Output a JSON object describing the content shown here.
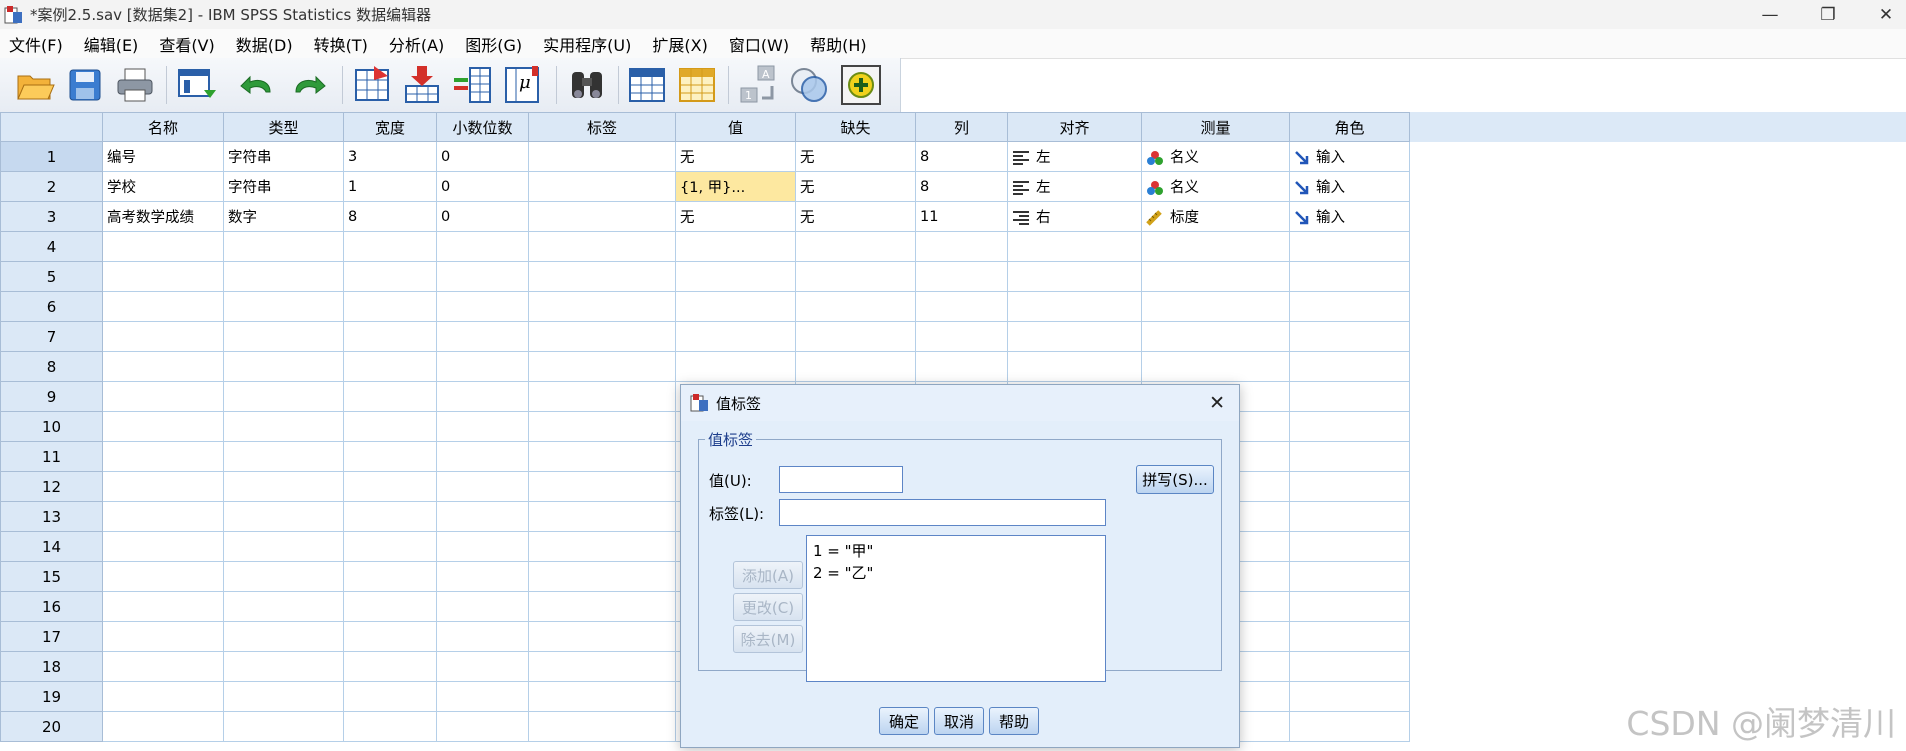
{
  "window": {
    "title": "*案例2.5.sav [数据集2] - IBM SPSS Statistics 数据编辑器",
    "minimize": "—",
    "restore": "❐",
    "close": "✕"
  },
  "menu": [
    "文件(F)",
    "编辑(E)",
    "查看(V)",
    "数据(D)",
    "转换(T)",
    "分析(A)",
    "图形(G)",
    "实用程序(U)",
    "扩展(X)",
    "窗口(W)",
    "帮助(H)"
  ],
  "toolbar": {
    "icons": [
      "open-icon",
      "save-icon",
      "print-icon",
      "recall-dialog-icon",
      "undo-icon",
      "redo-icon",
      "goto-case-icon",
      "goto-variable-icon",
      "variables-icon",
      "run-descriptive-icon",
      "find-icon",
      "split-file-icon",
      "select-cases-icon",
      "value-labels-icon",
      "use-sets-icon",
      "spelling-icon"
    ]
  },
  "grid": {
    "headers": [
      "名称",
      "类型",
      "宽度",
      "小数位数",
      "标签",
      "值",
      "缺失",
      "列",
      "对齐",
      "测量",
      "角色"
    ],
    "rows": [
      {
        "num": "1",
        "name": "编号",
        "type": "字符串",
        "width": "3",
        "decimals": "0",
        "label": "",
        "values": "无",
        "missing": "无",
        "columns": "8",
        "align": "左",
        "measure": "名义",
        "role": "输入"
      },
      {
        "num": "2",
        "name": "学校",
        "type": "字符串",
        "width": "1",
        "decimals": "0",
        "label": "",
        "values": "{1, 甲}...",
        "missing": "无",
        "columns": "8",
        "align": "左",
        "measure": "名义",
        "role": "输入"
      },
      {
        "num": "3",
        "name": "高考数学成绩",
        "type": "数字",
        "width": "8",
        "decimals": "0",
        "label": "",
        "values": "无",
        "missing": "无",
        "columns": "11",
        "align": "右",
        "measure": "标度",
        "role": "输入"
      }
    ],
    "empty_rows": [
      "4",
      "5",
      "6",
      "7",
      "8",
      "9",
      "10",
      "11",
      "12",
      "13",
      "14",
      "15",
      "16",
      "17",
      "18",
      "19",
      "20"
    ]
  },
  "dialog": {
    "title": "值标签",
    "group_label": "值标签",
    "value_label": "值(U):",
    "label_label": "标签(L):",
    "value_input": "",
    "label_input": "",
    "spelling_button": "拼写(S)...",
    "add_button": "添加(A)",
    "change_button": "更改(C)",
    "remove_button": "除去(M)",
    "list_items": [
      "1 = \"甲\"",
      "2 = \"乙\""
    ],
    "ok_button": "确定",
    "cancel_button": "取消",
    "help_button": "帮助"
  },
  "watermark": "CSDN @阑梦清川"
}
